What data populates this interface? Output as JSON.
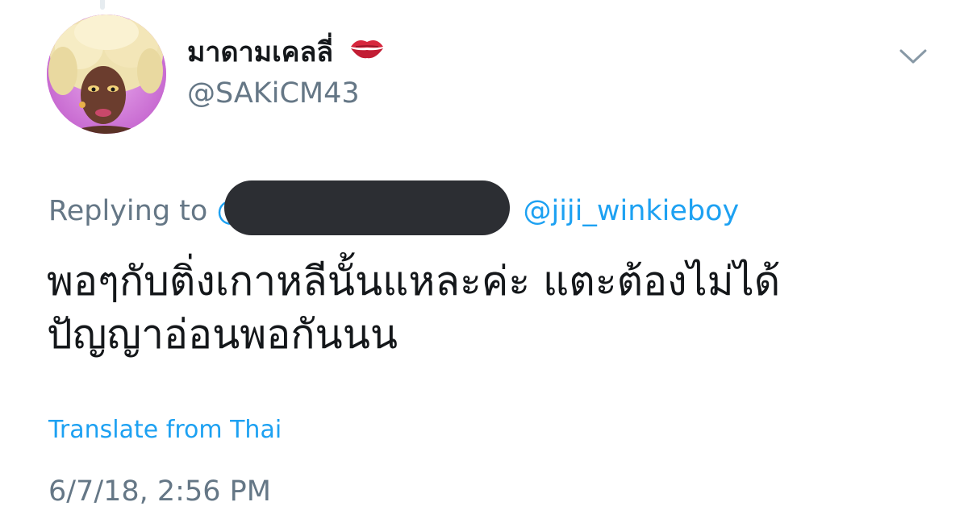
{
  "author": {
    "display_name": "มาดามเคลลี่",
    "handle": "@SAKiCM43",
    "avatar_icon": "drag-queen-portrait",
    "emoji_icon": "kiss-mark-icon"
  },
  "reply": {
    "label": "Replying to",
    "redacted_prefix": "@",
    "mention": "@jiji_winkieboy"
  },
  "tweet": {
    "text": "พอๆกับติ่งเกาหลีนั้นแหละค่ะ แตะต้องไม่ได้ ปัญญาอ่อนพอกันนน",
    "translate_label": "Translate from Thai",
    "timestamp": "6/7/18, 2:56 PM"
  },
  "menu": {
    "icon": "chevron-down-icon"
  },
  "colors": {
    "link": "#1da1f2",
    "secondary_text": "#657786",
    "primary_text": "#14171a",
    "redaction": "#2c2e33"
  }
}
